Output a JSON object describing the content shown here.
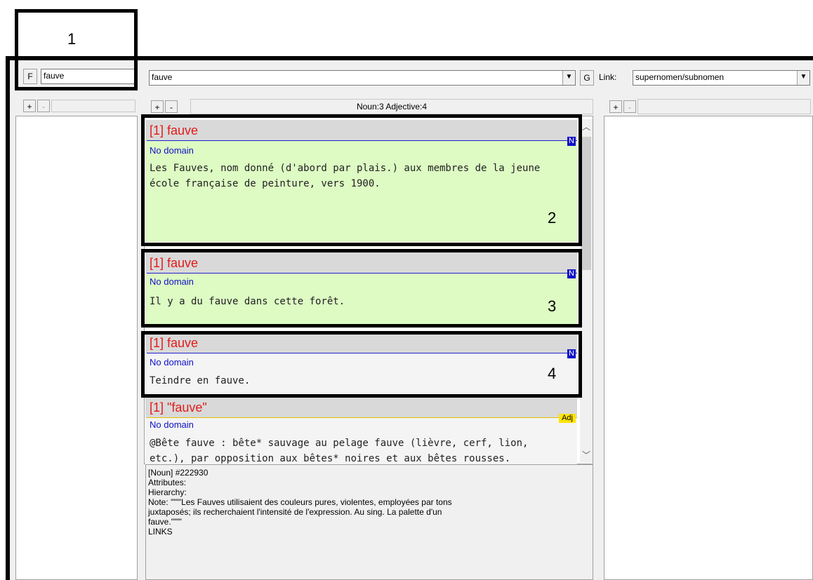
{
  "callouts": {
    "one": "1",
    "two": "2",
    "three": "3",
    "four": "4"
  },
  "left": {
    "f_button": "F",
    "search_value": "fauve",
    "plus": "+",
    "minus": "-"
  },
  "middle": {
    "search_value": "fauve",
    "g_button": "G",
    "plus": "+",
    "minus": "-",
    "summary": "Noun:3 Adjective:4"
  },
  "right": {
    "link_label": "Link:",
    "link_value": "supernomen/subnomen",
    "plus": "+",
    "minus": "-"
  },
  "entries": [
    {
      "title": "[1] fauve",
      "pos": "N",
      "domain": "No domain",
      "text": "Les Fauves, nom donné (d'abord par plais.) aux membres de la jeune école française de peinture, vers 1900."
    },
    {
      "title": "[1] fauve",
      "pos": "N",
      "domain": "No domain",
      "text": "Il y a du fauve dans cette forêt."
    },
    {
      "title": "[1] fauve",
      "pos": "N",
      "domain": "No domain",
      "text": "Teindre en fauve."
    },
    {
      "title": "[1] \"fauve\"",
      "pos": "Adj",
      "domain": "No domain",
      "text": "@Bête fauve : bête* sauvage au pelage fauve (lièvre, cerf, lion, etc.), par opposition aux bêtes* noires et aux bêtes rousses."
    }
  ],
  "info": {
    "line1": "[Noun] #222930",
    "line2": "Attributes:",
    "line3": "Hierarchy:",
    "line4": "Note: '\"\"\"Les Fauves utilisaient des couleurs pures, violentes, employées par tons",
    "line5": "juxtaposés; ils recherchaient l'intensité de l'expression. Au sing. La palette d'un",
    "line6": "fauve.'\"\"\"",
    "line7": "LINKS"
  },
  "colors": {
    "title_red": "#e31a1a",
    "domain_blue": "#1010c8",
    "card_green": "#ddfbc3",
    "badge_yellow": "#ffe400"
  }
}
